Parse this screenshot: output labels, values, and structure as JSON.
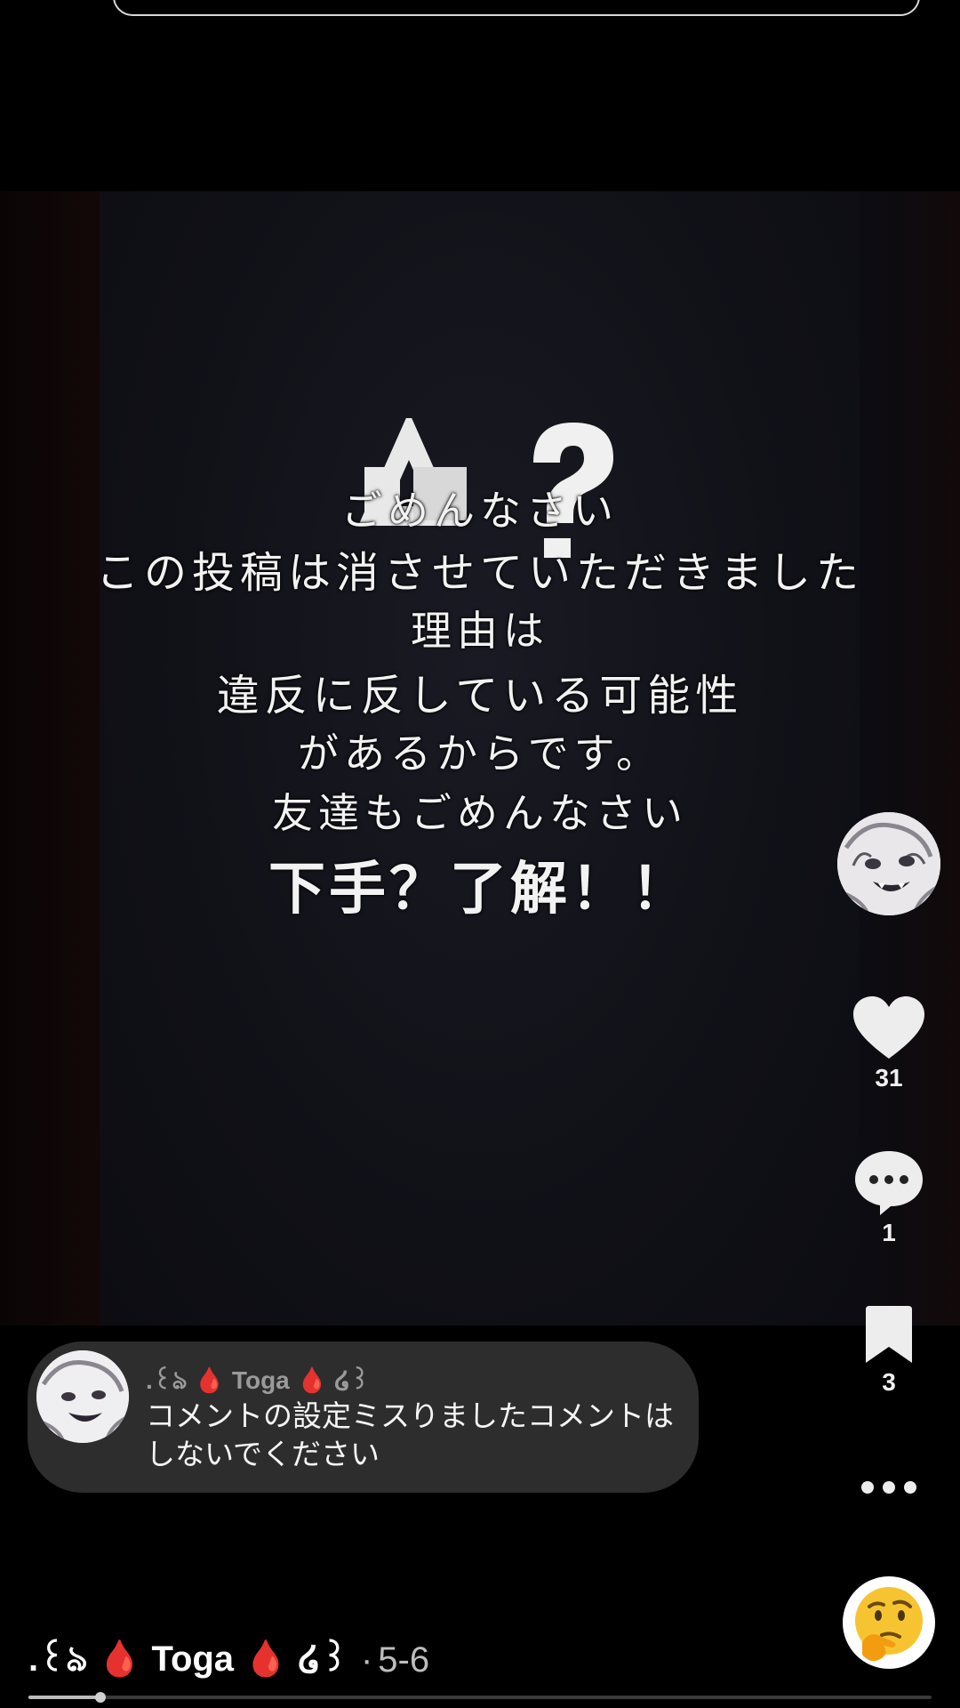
{
  "video": {
    "lines": [
      "ごめんなさい",
      "この投稿は消させていただきました",
      "理由は",
      "違反に反している可能性",
      "があるからです。",
      "友達もごめんなさい",
      "下手？了解！！"
    ]
  },
  "actions": {
    "likes": "31",
    "comments": "1",
    "saves": "3"
  },
  "pinned_comment": {
    "username": ".꒰ঌ 🩸 Toga 🩸 ໒꒱",
    "text": "コメントの設定ミスりましたコメントはしないでください"
  },
  "footer": {
    "username": ".꒰ঌ 🩸 Toga 🩸 ໒꒱",
    "separator": "·",
    "date": "5-6"
  },
  "playback": {
    "progress": 0.08
  },
  "icons": {
    "like": "heart-icon",
    "comment": "comment-bubble-icon",
    "save": "bookmark-icon",
    "more": "more-dots-icon",
    "reaction": "thinking-emoji-icon"
  },
  "colors": {
    "background": "#000000",
    "bubble": "#3c3c3c",
    "blood": "#c4000b"
  }
}
